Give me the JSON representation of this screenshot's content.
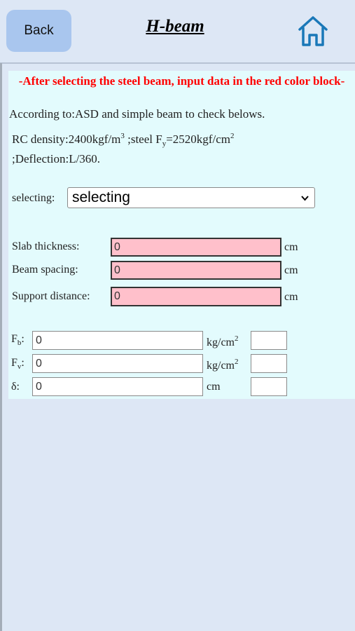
{
  "header": {
    "back_label": "Back",
    "title": "H-beam",
    "home_icon": "home-icon"
  },
  "notice": "-After selecting the steel beam, input data in the red color block-",
  "info": {
    "line1": "According to:ASD and simple beam to check belows.",
    "rc_density": "RC density:2400kgf/m",
    "rc_density_sup": "3",
    "steel_prefix": " ;steel F",
    "steel_sub": "y",
    "steel_value": "=2520kgf/cm",
    "steel_sup": "2",
    "deflection": ";Deflection:L/360."
  },
  "selector": {
    "label": "selecting:",
    "value": "selecting"
  },
  "inputs": {
    "slab_thickness": {
      "label": "Slab thickness:",
      "value": "0",
      "unit": "cm"
    },
    "beam_spacing": {
      "label": "Beam spacing:",
      "value": "0",
      "unit": "cm"
    },
    "support_distance": {
      "label": "Support distance:",
      "value": "0",
      "unit": "cm"
    }
  },
  "results": {
    "fb": {
      "label": "F",
      "sub": "b",
      "colon": ":",
      "value": "0",
      "unit": "kg/cm",
      "unit_sup": "2",
      "check": ""
    },
    "fv": {
      "label": "F",
      "sub": "v",
      "colon": ":",
      "value": "0",
      "unit": "kg/cm",
      "unit_sup": "2",
      "check": ""
    },
    "delta": {
      "label": "δ:",
      "value": "0",
      "unit": "cm",
      "check": ""
    }
  },
  "colors": {
    "background": "#dde7f5",
    "back_button": "#a9c6ee",
    "panel": "#e3fbfd",
    "notice": "#ff0000",
    "input_required": "#ffc0cb",
    "home_icon": "#1a78b8"
  }
}
